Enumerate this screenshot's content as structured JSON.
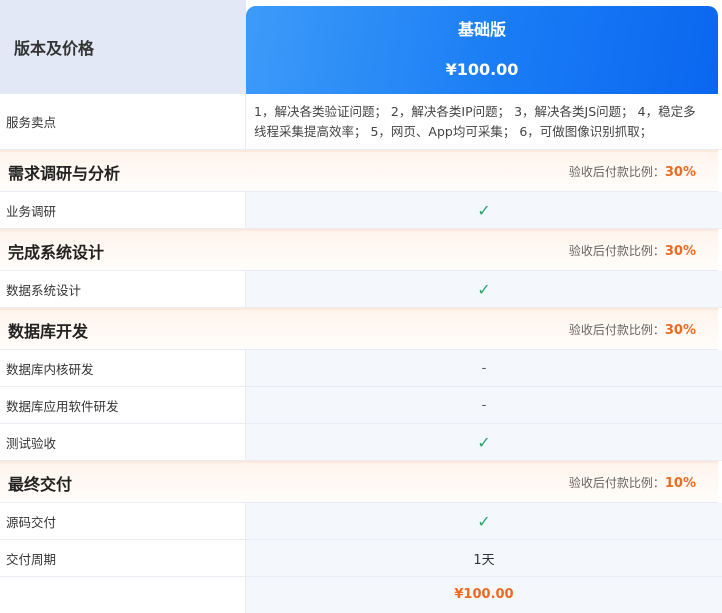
{
  "header": {
    "title": "版本及价格",
    "plan_name": "基础版",
    "plan_price": "¥100.00"
  },
  "selling_points": {
    "label": "服务卖点",
    "text": "1，解决各类验证问题；  2，解决各类IP问题；  3，解决各类JS问题；  4，稳定多线程采集提高效率；  5，网页、App均可采集；  6，可做图像识别抓取；"
  },
  "ratio_label": "验收后付款比例：",
  "sections": [
    {
      "title": "需求调研与分析",
      "ratio": "30%",
      "items": [
        {
          "label": "业务调研",
          "value": "✓",
          "kind": "check"
        }
      ]
    },
    {
      "title": "完成系统设计",
      "ratio": "30%",
      "items": [
        {
          "label": "数据系统设计",
          "value": "✓",
          "kind": "check"
        }
      ]
    },
    {
      "title": "数据库开发",
      "ratio": "30%",
      "items": [
        {
          "label": "数据库内核研发",
          "value": "-",
          "kind": "dash"
        },
        {
          "label": "数据库应用软件研发",
          "value": "-",
          "kind": "dash"
        },
        {
          "label": "测试验收",
          "value": "✓",
          "kind": "check"
        }
      ]
    },
    {
      "title": "最终交付",
      "ratio": "10%",
      "items": [
        {
          "label": "源码交付",
          "value": "✓",
          "kind": "check"
        },
        {
          "label": "交付周期",
          "value": "1天",
          "kind": "text"
        }
      ]
    }
  ],
  "total": {
    "price": "¥100.00"
  },
  "colors": {
    "accent": "#ee6a1e",
    "header_blue": "#1a7cf5",
    "check_green": "#2aa868"
  }
}
